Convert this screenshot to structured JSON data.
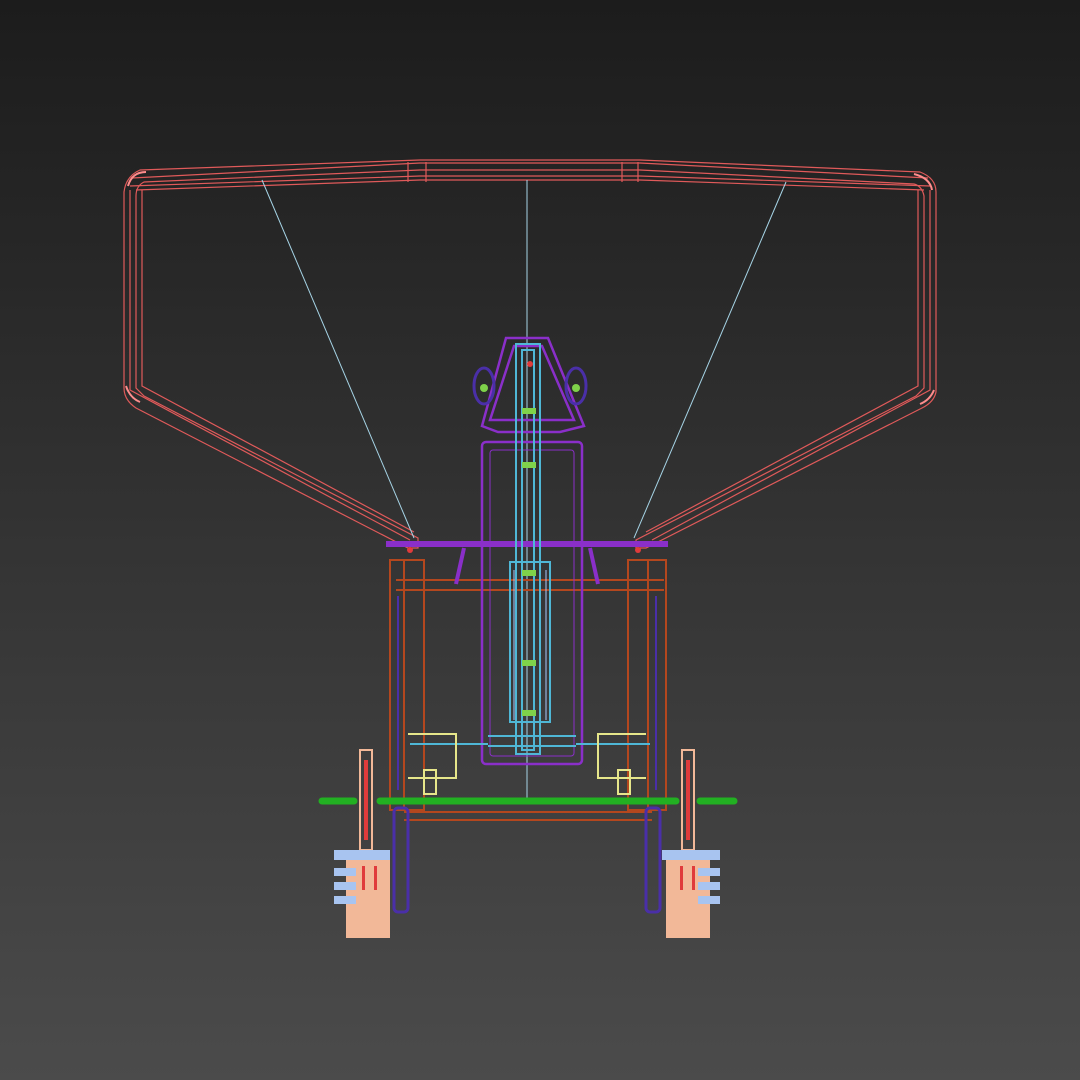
{
  "viewport": {
    "background_top": "#1c1c1c",
    "background_bottom": "#4b4b4b"
  },
  "model": {
    "hopper_color": "#e05a5a",
    "hopper_highlight": "#ff8c8c",
    "support_wire_color": "#a6d4e6",
    "chute_color": "#8a2fc9",
    "chute_accent": "#b040e0",
    "tube_color": "#4fb7d6",
    "tube_light": "#a8c8ff",
    "frame_color": "#b4471e",
    "axle_color": "#22b022",
    "bracket_color": "#e6e68a",
    "leg_color": "#4a2fa8",
    "post_color": "#f2b898",
    "clamp_color": "#a8c4f0",
    "bolt_color": "#7fd24a",
    "dot_color": "#e03b3b"
  }
}
